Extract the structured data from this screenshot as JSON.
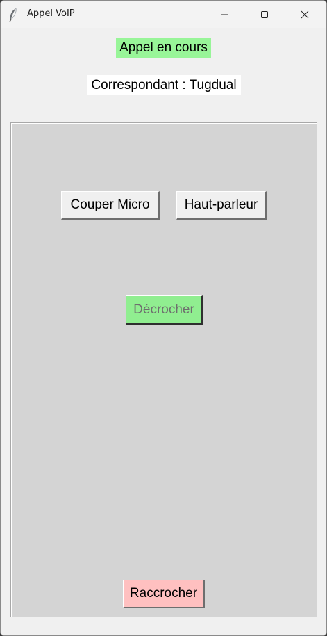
{
  "window": {
    "title": "Appel VoIP",
    "app_icon": "feather-icon",
    "controls": {
      "minimize_icon": "minimize-icon",
      "maximize_icon": "maximize-icon",
      "close_icon": "close-icon"
    }
  },
  "call": {
    "status": "Appel en cours",
    "status_color": "#98f598",
    "peer": "Correspondant : Tugdual"
  },
  "buttons": {
    "mute_mic": "Couper Micro",
    "speaker": "Haut-parleur",
    "answer": "Décrocher",
    "hangup": "Raccrocher"
  },
  "colors": {
    "panel": "#d4d4d4",
    "answer_bg": "#90ee90",
    "answer_text_disabled": "#6e6e6e",
    "hangup_bg": "#ffc0c0"
  }
}
